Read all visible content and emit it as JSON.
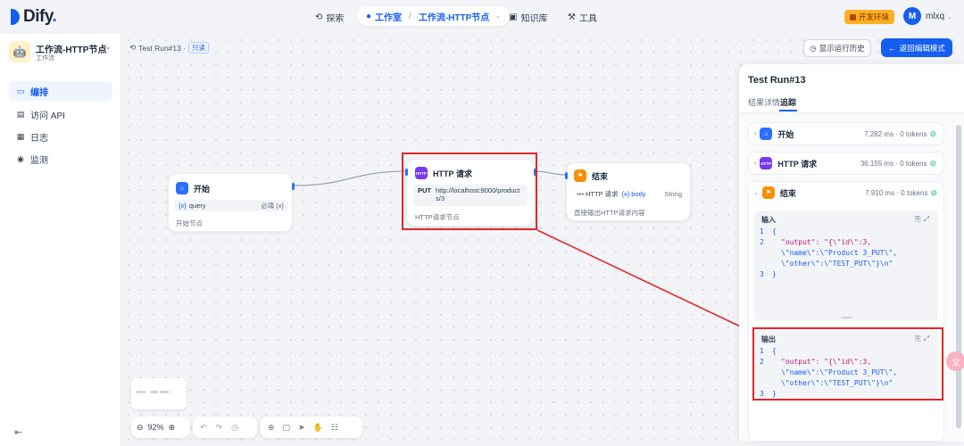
{
  "brand": {
    "name": "Dify",
    "dot": "."
  },
  "nav": {
    "explore": "探索",
    "studio": "工作室",
    "current_app": "工作流-HTTP节点",
    "knowledge": "知识库",
    "tools": "工具"
  },
  "env_badge": "开发环境",
  "user": {
    "initial": "M",
    "name": "mlxq"
  },
  "sidebar": {
    "app_name": "工作流-HTTP节点",
    "app_type": "工作流",
    "items": [
      {
        "label": "编排",
        "icon": "layout-icon",
        "active": true
      },
      {
        "label": "访问 API",
        "icon": "terminal-icon"
      },
      {
        "label": "日志",
        "icon": "file-list-icon"
      },
      {
        "label": "监测",
        "icon": "monitor-icon"
      }
    ]
  },
  "run": {
    "label": "Test Run#13 ·",
    "readonly": "只读"
  },
  "actions": {
    "history": "显示运行历史",
    "back": "返回编辑模式"
  },
  "nodes": {
    "start": {
      "title": "开始",
      "var_prefix": "{x}",
      "var": "query",
      "required": "必填",
      "var_type": "{x}",
      "desc": "开始节点"
    },
    "http": {
      "title": "HTTP 请求",
      "method": "PUT",
      "url": "http://localhost:9000/products/3",
      "desc": "HTTP请求节点"
    },
    "end": {
      "title": "结束",
      "var_source": "HTTP 请求",
      "var_prefix": "{x}",
      "var": "body",
      "var_type": "String",
      "desc": "直接输出HTTP请求内容"
    }
  },
  "toolbar": {
    "zoom": "92%"
  },
  "panel": {
    "title": "Test Run#13",
    "tabs": [
      "结果",
      "详情",
      "追踪"
    ],
    "trace": [
      {
        "title": "开始",
        "meta": "7.282 ms · 0 tokens"
      },
      {
        "title": "HTTP 请求",
        "meta": "36.155 ms · 0 tokens"
      },
      {
        "title": "结束",
        "meta": "7.910 ms · 0 tokens"
      }
    ],
    "input": {
      "label": "输入",
      "lines": [
        "{",
        "\"output\": \"{\\\"id\\\":3,",
        "\\\"name\\\":\\\"Product 3_PUT\\\",",
        "\\\"other\\\":\\\"TEST_PUT\\\"}\\n\"",
        "}"
      ]
    },
    "output": {
      "label": "输出",
      "lines": [
        "{",
        "\"output\": \"{\\\"id\\\":3,",
        "\\\"name\\\":\\\"Product 3_PUT\\\",",
        "\\\"other\\\":\\\"TEST_PUT\\\"}\\n\"",
        "}"
      ]
    }
  },
  "colors": {
    "accent": "#155eef",
    "annotation": "#e5252a",
    "success": "#12b76a"
  }
}
